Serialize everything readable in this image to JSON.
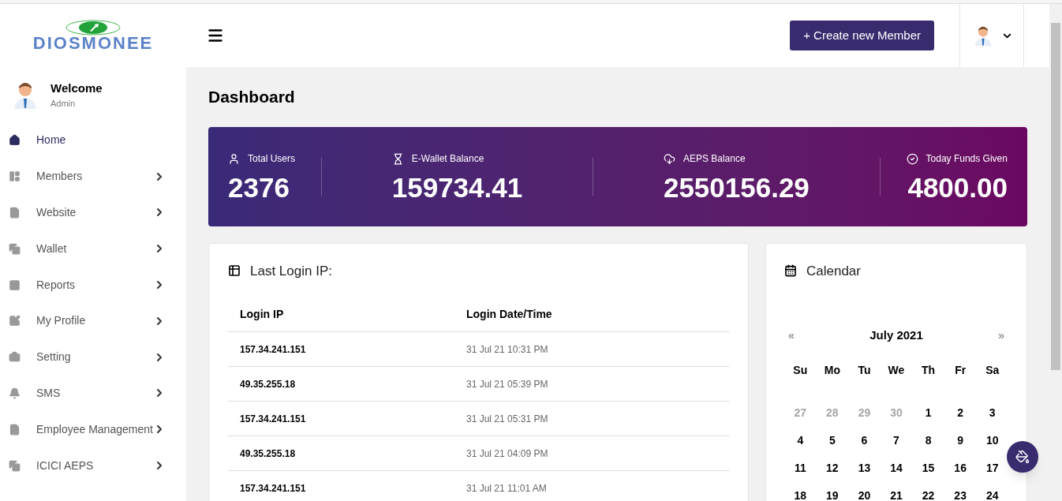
{
  "brand": {
    "logo_text": "DIOSMONEE"
  },
  "user": {
    "greeting": "Welcome",
    "role": "Admin"
  },
  "sidebar": {
    "items": [
      {
        "label": "Home",
        "selected": true,
        "has_submenu": false
      },
      {
        "label": "Members",
        "selected": false,
        "has_submenu": true
      },
      {
        "label": "Website",
        "selected": false,
        "has_submenu": true
      },
      {
        "label": "Wallet",
        "selected": false,
        "has_submenu": true
      },
      {
        "label": "Reports",
        "selected": false,
        "has_submenu": true
      },
      {
        "label": "My Profile",
        "selected": false,
        "has_submenu": true
      },
      {
        "label": "Setting",
        "selected": false,
        "has_submenu": true
      },
      {
        "label": "SMS",
        "selected": false,
        "has_submenu": true
      },
      {
        "label": "Employee Management",
        "selected": false,
        "has_submenu": true
      },
      {
        "label": "ICICI AEPS",
        "selected": false,
        "has_submenu": true
      }
    ]
  },
  "header": {
    "create_button": "+ Create new Member"
  },
  "page_title": "Dashboard",
  "stats": [
    {
      "label": "Total Users",
      "value": "2376"
    },
    {
      "label": "E-Wallet Balance",
      "value": "159734.41"
    },
    {
      "label": "AEPS Balance",
      "value": "2550156.29"
    },
    {
      "label": "Today Funds Given",
      "value": "4800.00"
    }
  ],
  "login_table": {
    "title": "Last Login IP:",
    "columns": [
      "Login IP",
      "Login Date/Time"
    ],
    "rows": [
      [
        "157.34.241.151",
        "31 Jul 21 10:31 PM"
      ],
      [
        "49.35.255.18",
        "31 Jul 21 05:39 PM"
      ],
      [
        "157.34.241.151",
        "31 Jul 21 05:31 PM"
      ],
      [
        "49.35.255.18",
        "31 Jul 21 04:09 PM"
      ],
      [
        "157.34.241.151",
        "31 Jul 21 11:01 AM"
      ]
    ]
  },
  "calendar": {
    "title": "Calendar",
    "prev": "«",
    "next": "»",
    "month": "July 2021",
    "weekdays": [
      "Su",
      "Mo",
      "Tu",
      "We",
      "Th",
      "Fr",
      "Sa"
    ],
    "days": [
      {
        "label": "27",
        "muted": true
      },
      {
        "label": "28",
        "muted": true
      },
      {
        "label": "29",
        "muted": true
      },
      {
        "label": "30",
        "muted": true
      },
      {
        "label": "1",
        "muted": false
      },
      {
        "label": "2",
        "muted": false
      },
      {
        "label": "3",
        "muted": false
      },
      {
        "label": "4",
        "muted": false
      },
      {
        "label": "5",
        "muted": false
      },
      {
        "label": "6",
        "muted": false
      },
      {
        "label": "7",
        "muted": false
      },
      {
        "label": "8",
        "muted": false
      },
      {
        "label": "9",
        "muted": false
      },
      {
        "label": "10",
        "muted": false
      },
      {
        "label": "11",
        "muted": false
      },
      {
        "label": "12",
        "muted": false
      },
      {
        "label": "13",
        "muted": false
      },
      {
        "label": "14",
        "muted": false
      },
      {
        "label": "15",
        "muted": false
      },
      {
        "label": "16",
        "muted": false
      },
      {
        "label": "17",
        "muted": false
      },
      {
        "label": "18",
        "muted": false
      },
      {
        "label": "19",
        "muted": false
      },
      {
        "label": "20",
        "muted": false
      },
      {
        "label": "21",
        "muted": false
      },
      {
        "label": "22",
        "muted": false
      },
      {
        "label": "23",
        "muted": false
      },
      {
        "label": "24",
        "muted": false
      }
    ]
  }
}
